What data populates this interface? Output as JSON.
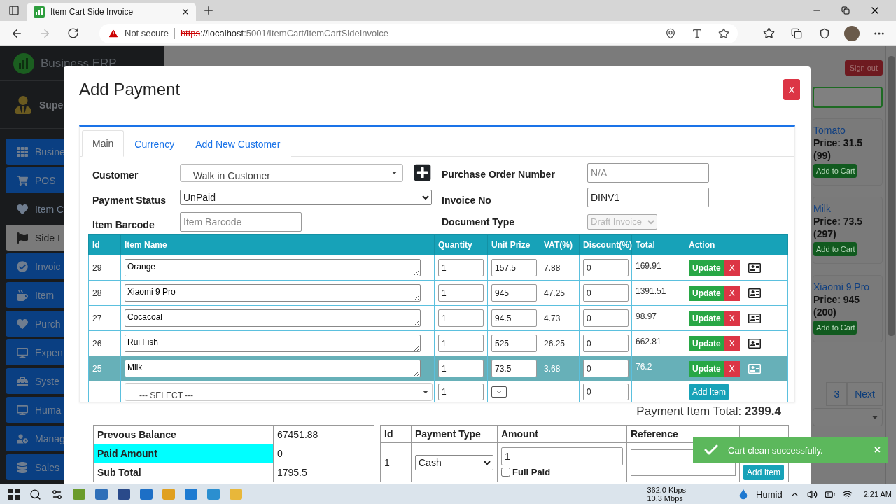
{
  "browser": {
    "tab_title": "Item Cart Side Invoice",
    "security": "Not secure",
    "url_scheme": "https",
    "url_host": "://localhost",
    "url_path": ":5001/ItemCart/ItemCartSideInvoice"
  },
  "app": {
    "brand": "Business ERP",
    "user": "Supe",
    "sign_out": "Sign out",
    "sidebar": [
      {
        "label": "Busine",
        "kind": "button",
        "selected": false
      },
      {
        "label": "POS",
        "kind": "button",
        "selected": false
      },
      {
        "label": "Item C",
        "kind": "plain",
        "selected": false
      },
      {
        "label": "Side I",
        "kind": "button",
        "selected": true
      },
      {
        "label": "Invoic",
        "kind": "button",
        "selected": false
      },
      {
        "label": "Item",
        "kind": "button",
        "selected": false
      },
      {
        "label": "Purch",
        "kind": "button",
        "selected": false
      },
      {
        "label": "Expen",
        "kind": "button",
        "selected": false
      },
      {
        "label": "Syste",
        "kind": "button",
        "selected": false
      },
      {
        "label": "Huma",
        "kind": "button",
        "selected": false
      },
      {
        "label": "Manag",
        "kind": "button",
        "selected": false
      },
      {
        "label": "Sales",
        "kind": "button",
        "selected": false
      }
    ],
    "products": [
      {
        "name": "Tomato",
        "price": "Price: 31.5",
        "stock": "(99)",
        "button": "Add to Cart"
      },
      {
        "name": "Milk",
        "price": "Price: 73.5",
        "stock": "(297)",
        "button": "Add to Cart"
      },
      {
        "name": "Xiaomi 9 Pro",
        "price": "Price: 945",
        "stock": "(200)",
        "button": "Add to Cart"
      }
    ],
    "pagination": [
      "3",
      "Next"
    ]
  },
  "modal": {
    "title": "Add Payment",
    "close": "X",
    "tabs": [
      {
        "label": "Main",
        "selected": true
      },
      {
        "label": "Currency",
        "selected": false
      },
      {
        "label": "Add New Customer",
        "selected": false
      }
    ],
    "form": {
      "customer_label": "Customer",
      "customer": "Walk in Customer",
      "payment_status_label": "Payment Status",
      "payment_status": "UnPaid",
      "item_barcode_label": "Item Barcode",
      "item_barcode_placeholder": "Item Barcode",
      "purchase_order_label": "Purchase Order Number",
      "purchase_order_placeholder": "N/A",
      "invoice_no_label": "Invoice No",
      "invoice_no": "DINV1",
      "document_type_label": "Document Type",
      "document_type": {
        "value": "Draft Invoice",
        "disabled": true
      }
    },
    "items_table": {
      "columns": [
        "Id",
        "Item Name",
        "Quantity",
        "Unit Prize",
        "VAT(%)",
        "Discount(%)",
        "Total",
        "Action"
      ],
      "rows": [
        {
          "id": "29",
          "name": "Orange",
          "quantity": "1",
          "unit_price": "157.5",
          "vat": "7.88",
          "discount": "0",
          "total": "169.91",
          "update": "Update",
          "remove": "X",
          "selected": false
        },
        {
          "id": "28",
          "name": "Xiaomi 9 Pro",
          "quantity": "1",
          "unit_price": "945",
          "vat": "47.25",
          "discount": "0",
          "total": "1391.51",
          "update": "Update",
          "remove": "X",
          "selected": false
        },
        {
          "id": "27",
          "name": "Cocacoal",
          "quantity": "1",
          "unit_price": "94.5",
          "vat": "4.73",
          "discount": "0",
          "total": "98.97",
          "update": "Update",
          "remove": "X",
          "selected": false
        },
        {
          "id": "26",
          "name": "Rui Fish",
          "quantity": "1",
          "unit_price": "525",
          "vat": "26.25",
          "discount": "0",
          "total": "662.81",
          "update": "Update",
          "remove": "X",
          "selected": false
        },
        {
          "id": "25",
          "name": "Milk",
          "quantity": "1",
          "unit_price": "73.5",
          "vat": "3.68",
          "discount": "0",
          "total": "76.2",
          "update": "Update",
          "remove": "X",
          "selected": true
        }
      ],
      "new_row": {
        "item": "--- SELECT ---",
        "quantity": "1",
        "discount": "0",
        "button": "Add Item"
      }
    },
    "payment_item_total": {
      "label": "Payment Item Total:",
      "value": "2399.4"
    },
    "summary": [
      {
        "label": "Prevous Balance",
        "value": "67451.88",
        "highlighted": false
      },
      {
        "label": "Paid Amount",
        "value": "0",
        "highlighted": true
      },
      {
        "label": "Sub Total",
        "value": "1795.5",
        "highlighted": false
      }
    ],
    "payments": {
      "columns": [
        "Id",
        "Payment Type",
        "Amount",
        "Reference"
      ],
      "rows": [
        {
          "id": "1",
          "type": "Cash",
          "amount": "1",
          "full_paid_label": "Full Paid",
          "full_paid": false
        }
      ],
      "button": "Add Item"
    }
  },
  "toast": {
    "message": "Cart clean successfully.",
    "close": "×"
  },
  "taskbar": {
    "download": "362.0 Kbps",
    "upload": "10.3 Mbps",
    "weather": "Humid",
    "time": "2:21 AM"
  }
}
